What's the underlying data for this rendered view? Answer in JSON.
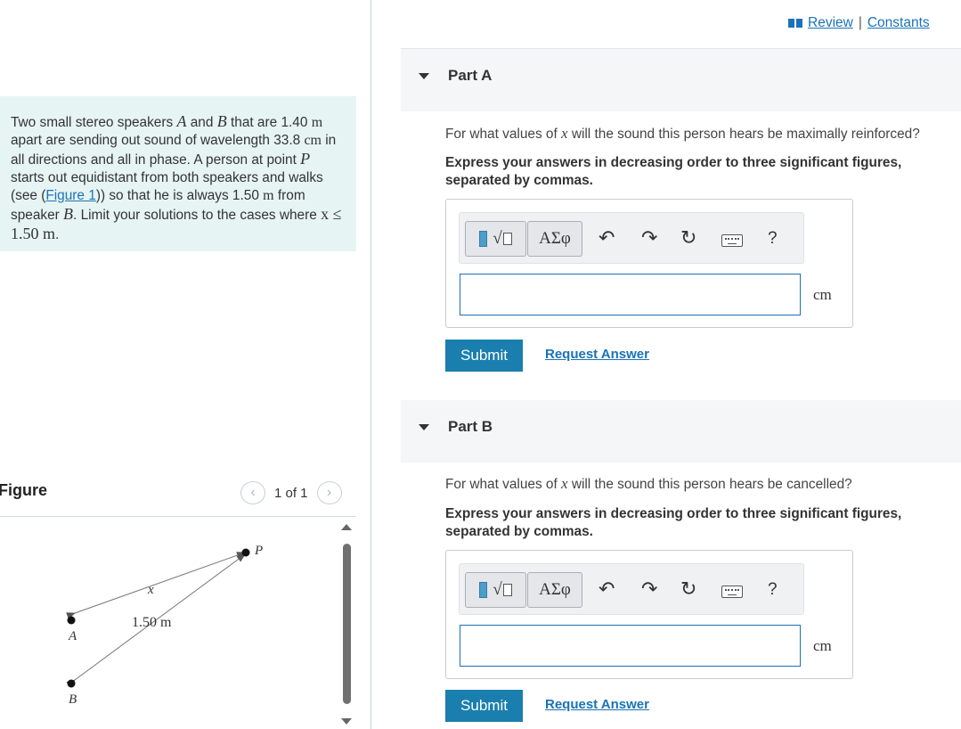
{
  "intro": {
    "t1": "Two small stereo speakers ",
    "A": "A",
    "t2": " and ",
    "B": "B",
    "t3": " that are 1.40",
    "u1": "m",
    "t4": " apart are sending out sound of wavelength 33.8",
    "u2": "cm",
    "t5": " in all directions and all in phase. A person at point ",
    "P": "P",
    "t6": " starts out equidistant from both speakers and walks (see (",
    "link": "Figure 1",
    "t7": ")) so that he is always 1.50",
    "u3": "m",
    "t8": " from speaker ",
    "B2": "B",
    "t9": ". Limit your solutions to the cases where ",
    "cond": "x ≤ 1.50 m",
    "t10": "."
  },
  "figure": {
    "title": "Figure",
    "pager": "1 of 1",
    "prev_icon": "chevron-left-icon",
    "next_icon": "chevron-right-icon",
    "label_P": "P",
    "label_A": "A",
    "label_B": "B",
    "label_x": "x",
    "label_dist": "1.50 m"
  },
  "header": {
    "review": "Review",
    "sep": "|",
    "constants": "Constants"
  },
  "parts": [
    {
      "title": "Part A",
      "q_pre": "For what values of ",
      "q_var": "x",
      "q_post": " will the sound this person hears be maximally reinforced?",
      "instruction": "Express your answers in decreasing order to three significant figures, separated by commas.",
      "greek": "ΑΣφ",
      "help": "?",
      "unit": "cm",
      "submit": "Submit",
      "request": "Request Answer"
    },
    {
      "title": "Part B",
      "q_pre": "For what values of ",
      "q_var": "x",
      "q_post": " will the sound this person hears be cancelled?",
      "instruction": "Express your answers in decreasing order to three significant figures, separated by commas.",
      "greek": "ΑΣφ",
      "help": "?",
      "unit": "cm",
      "submit": "Submit",
      "request": "Request Answer"
    }
  ],
  "colors": {
    "accent": "#1a7fae",
    "link": "#1a73b6",
    "intro_bg": "#e7f4f4"
  }
}
